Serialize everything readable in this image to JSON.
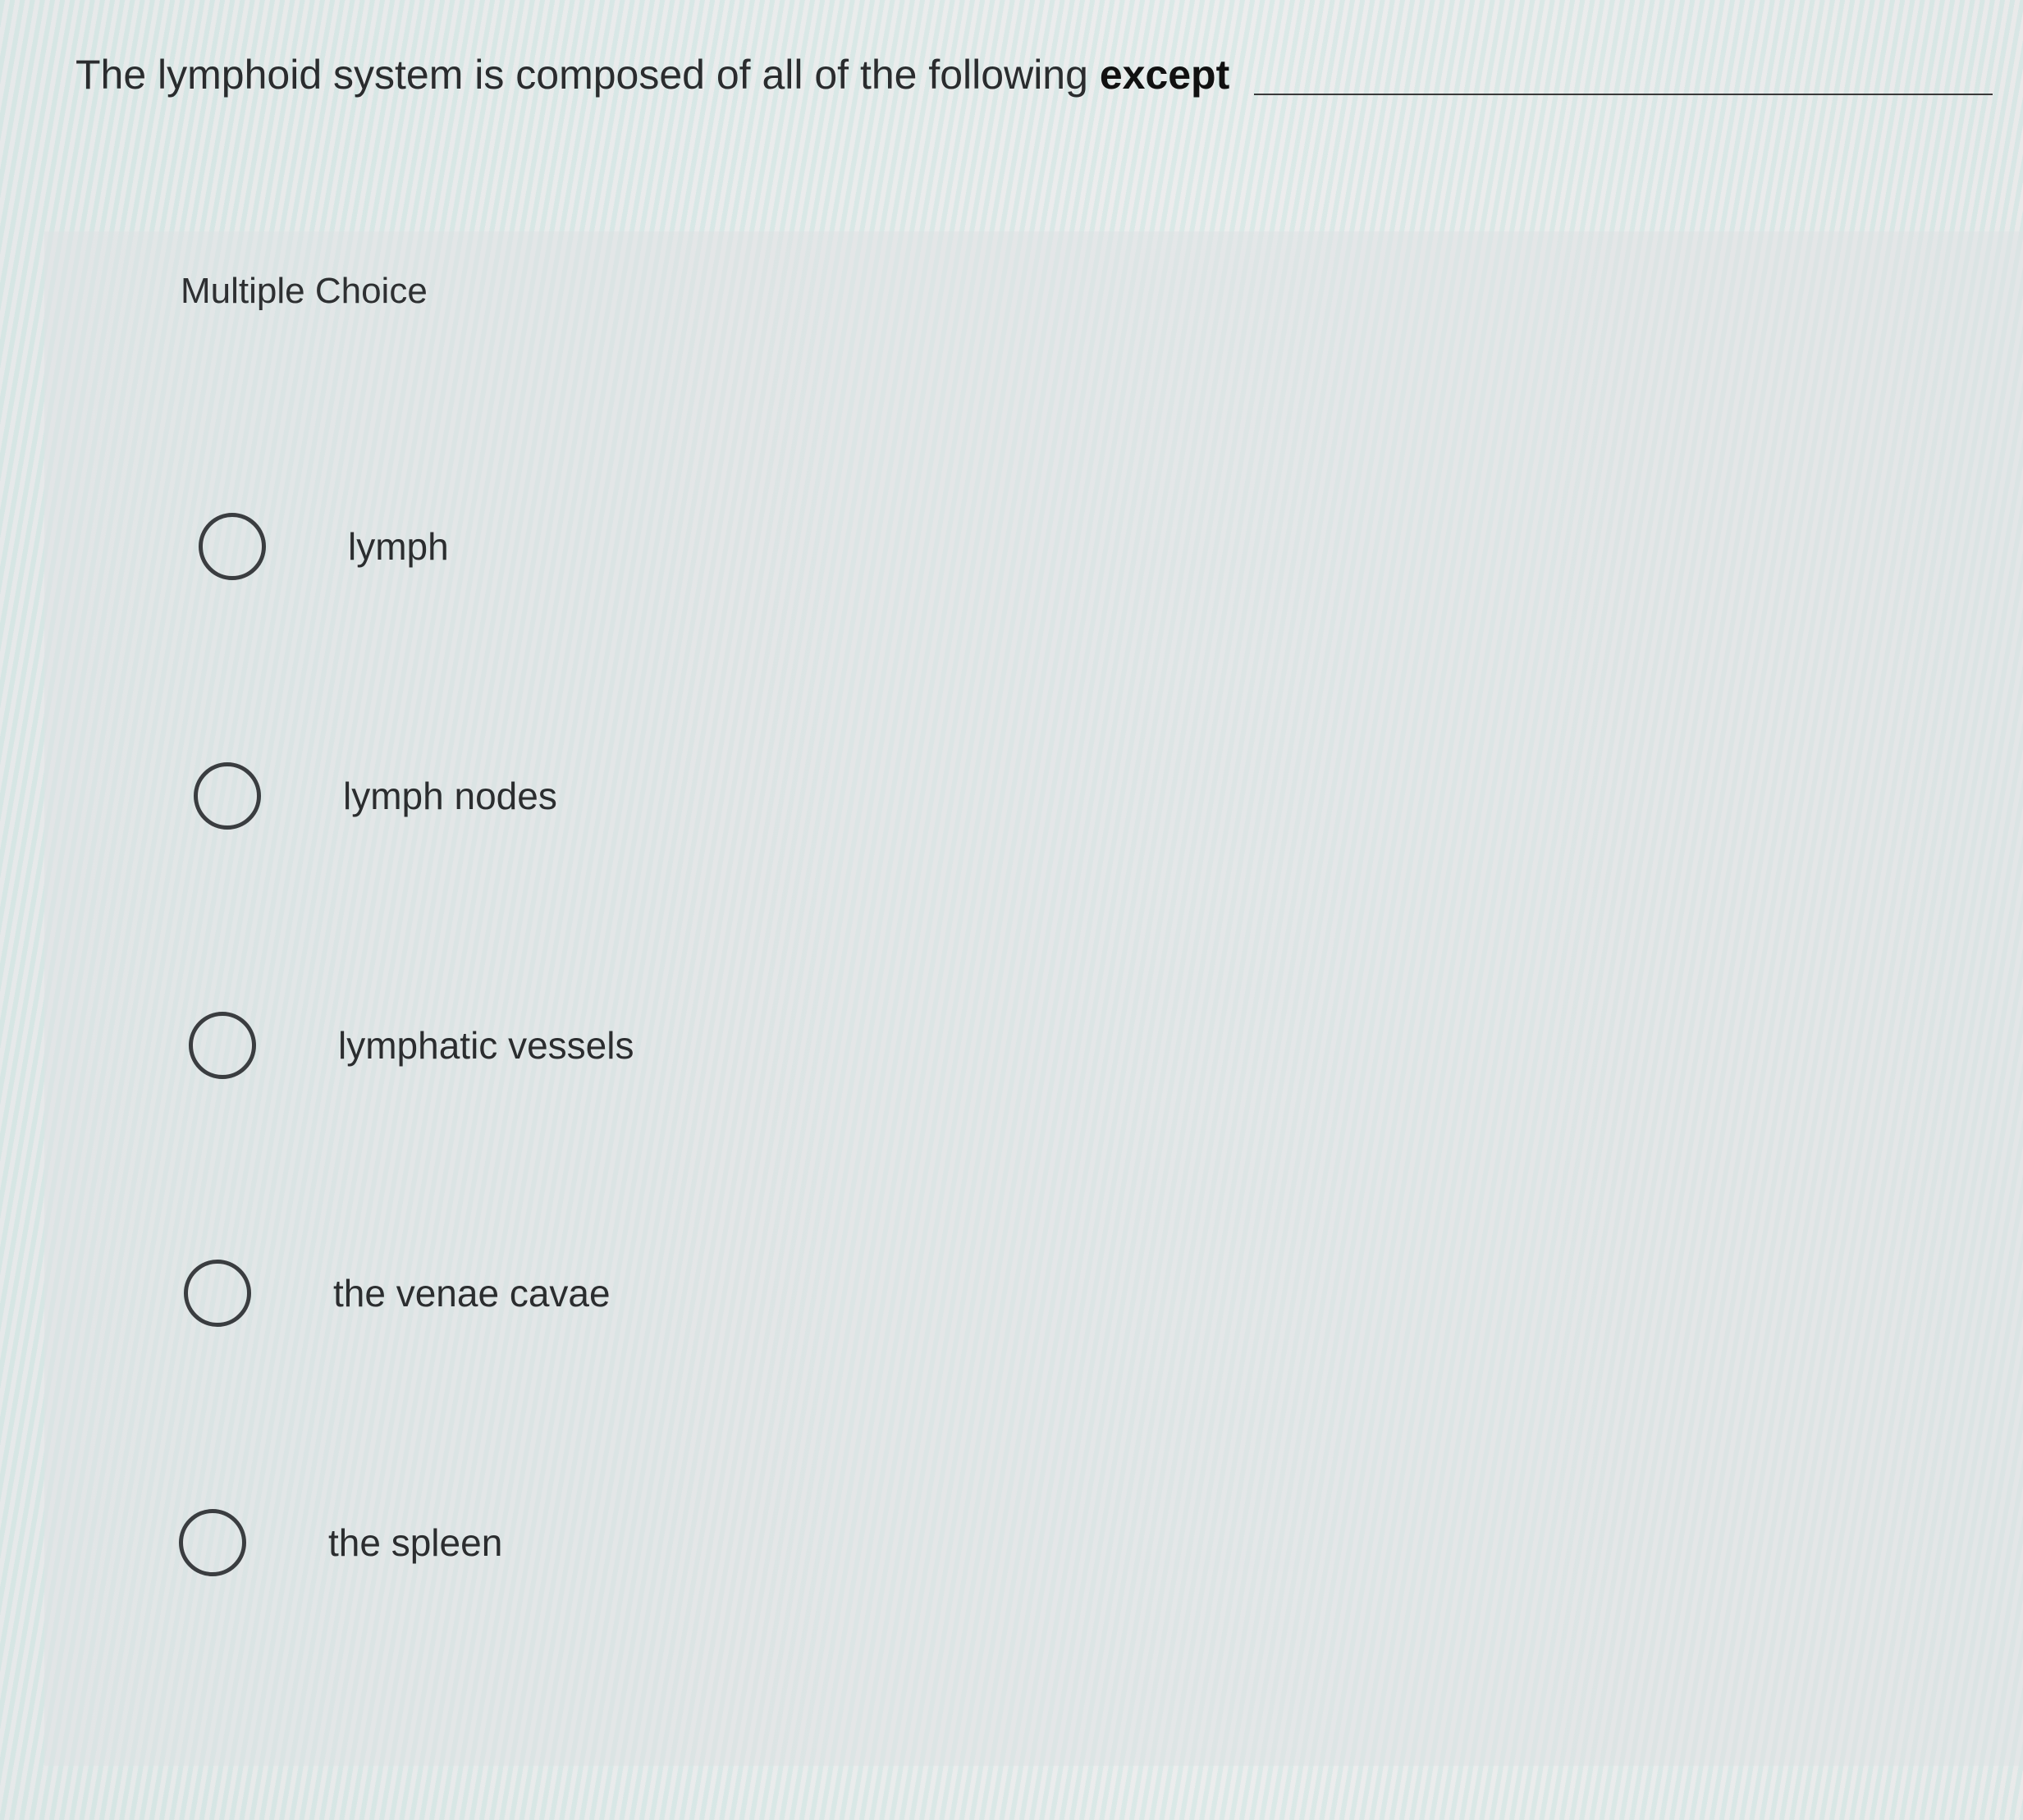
{
  "question": {
    "stem": "The lymphoid system is composed of all of the following",
    "emphasis": "except"
  },
  "section_label": "Multiple Choice",
  "options": [
    {
      "label": "lymph"
    },
    {
      "label": "lymph nodes"
    },
    {
      "label": "lymphatic vessels"
    },
    {
      "label": "the venae cavae"
    },
    {
      "label": "the spleen"
    }
  ]
}
